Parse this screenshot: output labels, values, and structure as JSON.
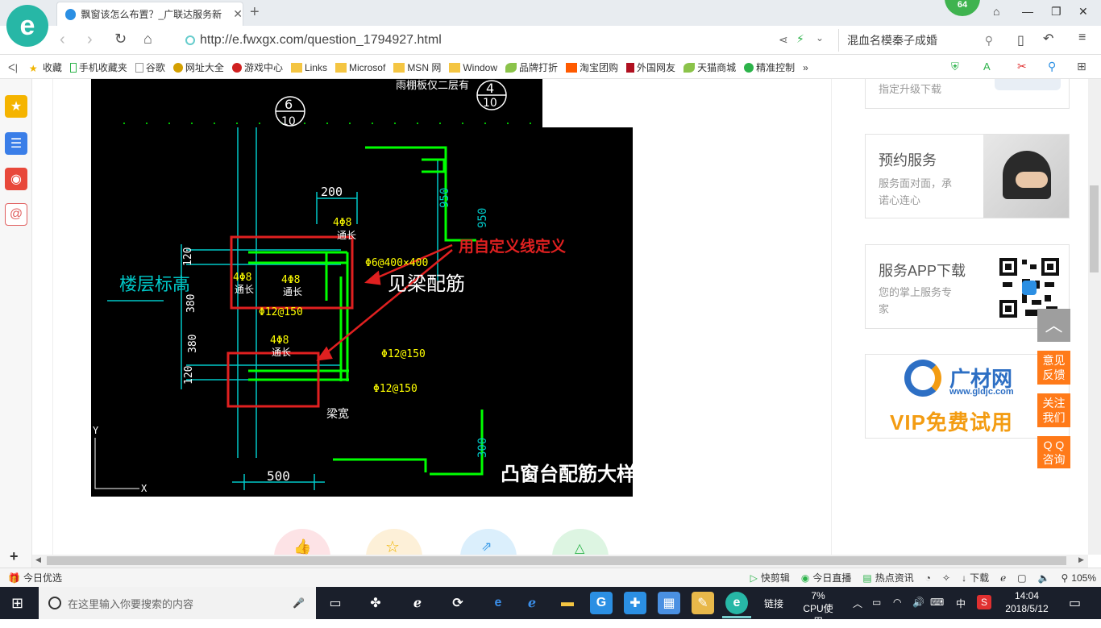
{
  "browser": {
    "tab_title": "飘窗该怎么布置？_广联达服务新",
    "new_tab": "+",
    "badge_count": "64",
    "url_prefix": "http://",
    "url_domain": "e.fwxgx.com",
    "url_path": "/question_1794927.html",
    "search_text": "混血名模秦子成婚"
  },
  "bookmarks": [
    {
      "label": "收藏"
    },
    {
      "label": "手机收藏夹"
    },
    {
      "label": "谷歌"
    },
    {
      "label": "网址大全"
    },
    {
      "label": "游戏中心"
    },
    {
      "label": "Links"
    },
    {
      "label": "Microsof"
    },
    {
      "label": "MSN 网"
    },
    {
      "label": "Window"
    },
    {
      "label": "品牌打折"
    },
    {
      "label": "淘宝团购"
    },
    {
      "label": "外国网友"
    },
    {
      "label": "天猫商城"
    },
    {
      "label": "精准控制"
    }
  ],
  "bookmark_more": "»",
  "cad": {
    "roof_note": "雨棚板仅二层有",
    "section_6_top": "6",
    "section_6_bottom": "10",
    "section_4_top": "4",
    "section_4_bottom": "10",
    "dim_200": "200",
    "dim_950_a": "950",
    "dim_950_b": "950",
    "rebar_4phi8_a": "4Φ8",
    "through_a": "通长",
    "rebar_stirrup": "Φ6@400×400",
    "floor_elev": "楼层标高",
    "rebar_4phi8_b": "4Φ8",
    "through_b": "通长",
    "rebar_4phi8_c": "4Φ8",
    "through_c": "通长",
    "see_beam": "见梁配筋",
    "phi12_a": "Φ12@150",
    "dim_120_a": "120",
    "dim_380_a": "380",
    "dim_380_b": "380",
    "dim_120_b": "120",
    "rebar_4phi8_d": "4Φ8",
    "through_d": "通长",
    "phi12_b": "Φ12@150",
    "phi12_c": "Φ12@150",
    "beam_width": "梁宽",
    "dim_300": "300",
    "dim_500": "500",
    "axis_x": "X",
    "axis_y": "Y",
    "title": "凸窗台配筋大样",
    "annotation": "用自定义线定义"
  },
  "sidebar": {
    "upgrade_link": "指定升级下载",
    "reserve_title": "预约服务",
    "reserve_sub_1": "服务面对面，承",
    "reserve_sub_2": "诺心连心",
    "app_title": "服务APP下载",
    "app_sub_1": "您的掌上服务专",
    "app_sub_2": "家",
    "ad_brand": "广材网",
    "ad_url": "www.gldjc.com",
    "ad_vip": "VIP免费试用"
  },
  "side_buttons": {
    "feedback_1": "意见",
    "feedback_2": "反馈",
    "follow_1": "关注",
    "follow_2": "我们",
    "qq_1": "Q Q",
    "qq_2": "咨询"
  },
  "statusbar": {
    "today": "今日优选",
    "kuaijian": "快剪辑",
    "live": "今日直播",
    "news": "热点资讯",
    "download": "下载",
    "zoom": "105%"
  },
  "taskbar": {
    "search_placeholder": "在这里输入你要搜索的内容",
    "links": "链接",
    "cpu_pct": "7%",
    "cpu_label": "CPU使用",
    "ime": "中",
    "time": "14:04",
    "date": "2018/5/12"
  },
  "colors": {
    "cad_bg": "#000000",
    "cad_green": "#00ff00",
    "cad_cyan": "#00c8c8",
    "cad_yellow": "#ffff00",
    "annotation_red": "#e02020",
    "accent_orange": "#ff7a19"
  }
}
